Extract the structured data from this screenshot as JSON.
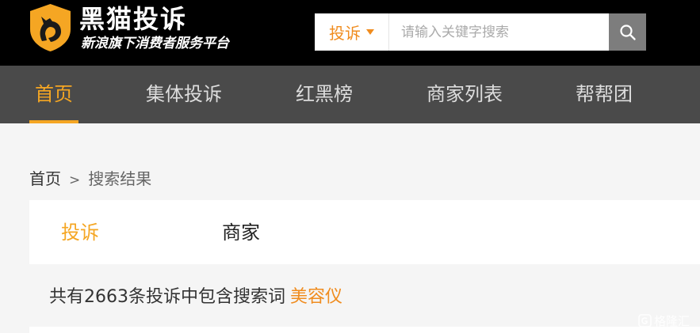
{
  "header": {
    "logo_title": "黑猫投诉",
    "logo_subtitle": "新浪旗下消费者服务平台",
    "search": {
      "type_label": "投诉",
      "placeholder": "请输入关键字搜索",
      "value": ""
    }
  },
  "nav": {
    "items": [
      {
        "label": "首页"
      },
      {
        "label": "集体投诉"
      },
      {
        "label": "红黑榜"
      },
      {
        "label": "商家列表"
      },
      {
        "label": "帮帮团"
      }
    ]
  },
  "breadcrumb": {
    "home": "首页",
    "separator": ">",
    "current": "搜索结果"
  },
  "tabs": [
    {
      "label": "投诉"
    },
    {
      "label": "商家"
    }
  ],
  "result": {
    "summary": "共有2663条投诉中包含搜索词",
    "keyword": "美容仪"
  },
  "watermark": {
    "text": "格隆汇"
  },
  "colors": {
    "accent": "#f5a623",
    "header_bg": "#000000",
    "nav_bg": "#4a4a4a"
  }
}
